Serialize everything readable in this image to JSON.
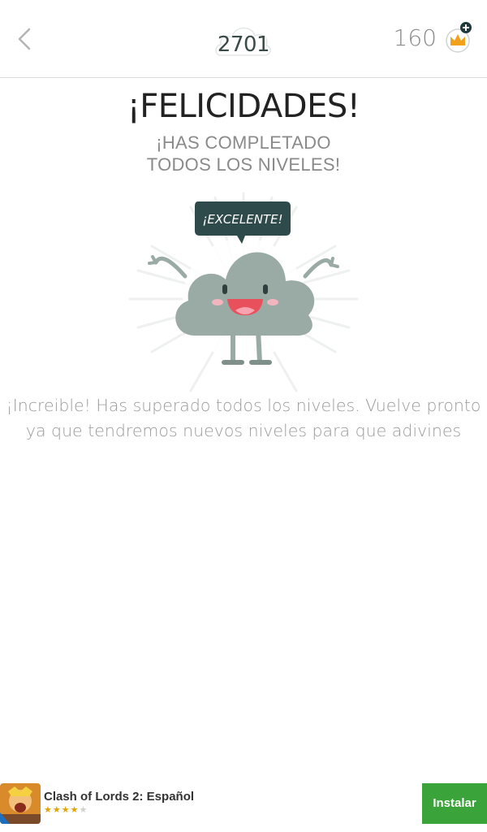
{
  "header": {
    "level_number": "2701",
    "coins": "160",
    "back_icon": "chevron-left-icon",
    "coin_icon": "crown-icon",
    "add_icon": "plus-icon"
  },
  "main": {
    "title": "¡FELICIDADES!",
    "subtitle_line1": "¡HAS COMPLETADO",
    "subtitle_line2": "TODOS LOS NIVELES!",
    "speech_bubble": "¡EXCELENTE!",
    "message": "¡Increible! Has superado todos los niveles. Vuelve pronto ya que tendremos nuevos niveles para que adivines"
  },
  "ad": {
    "app_name": "Clash of Lords 2: Español",
    "rating_filled": "★★★★",
    "rating_empty": "★",
    "install_label": "Instalar"
  },
  "colors": {
    "mascot": "#9aaba6",
    "bubble": "#2f4a4a",
    "install_button": "#3aa33a",
    "crown": "#f2a11a"
  }
}
